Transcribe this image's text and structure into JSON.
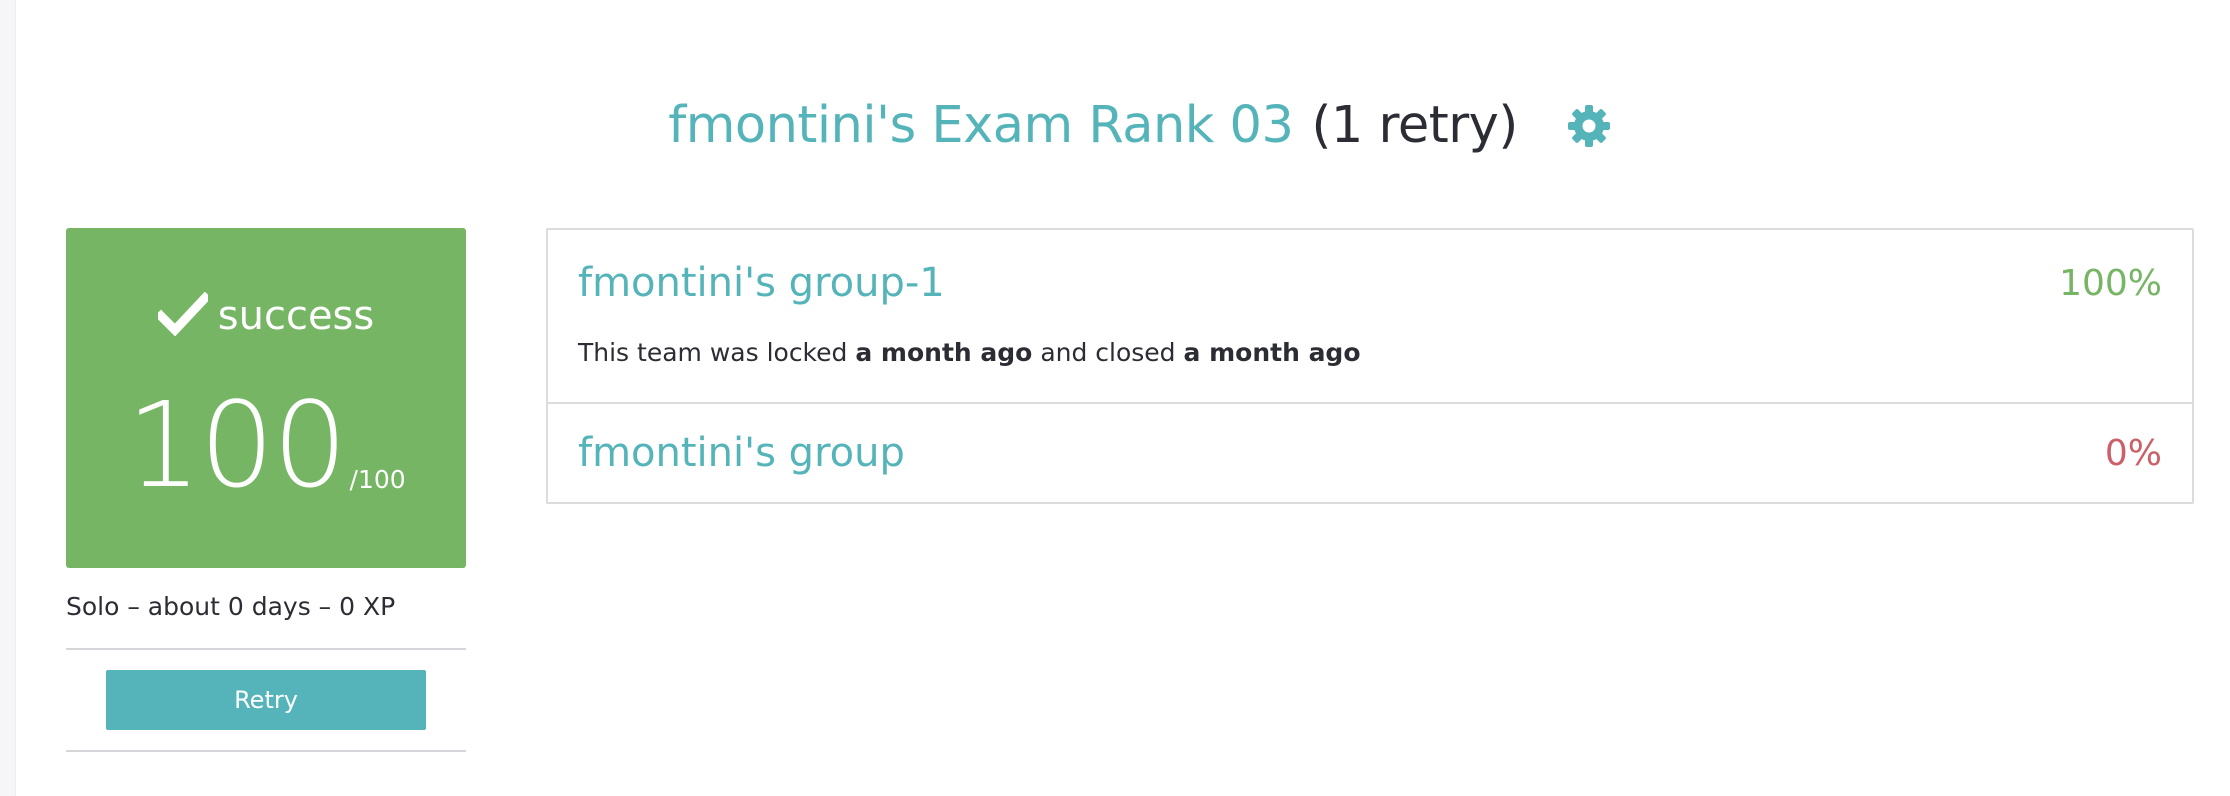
{
  "header": {
    "project_title": "fmontini's Exam Rank 03",
    "retry_count": "(1 retry)",
    "settings_icon": "gear-icon"
  },
  "score_card": {
    "status": "success",
    "status_icon": "checkmark-icon",
    "score": "100",
    "max": "/100",
    "background": "#76b563",
    "meta": "Solo – about 0 days – 0 XP",
    "retry_label": "Retry"
  },
  "groups": [
    {
      "name": "fmontini's group-1",
      "percent": "100%",
      "percent_color": "#76b563",
      "info_prefix": "This team was locked",
      "locked": "a month ago",
      "info_middle": "and closed",
      "closed": "a month ago"
    },
    {
      "name": "fmontini's group",
      "percent": "0%",
      "percent_color": "#cc6068"
    }
  ],
  "colors": {
    "accent": "#55b4b9",
    "success": "#76b563",
    "fail": "#cc6068"
  }
}
